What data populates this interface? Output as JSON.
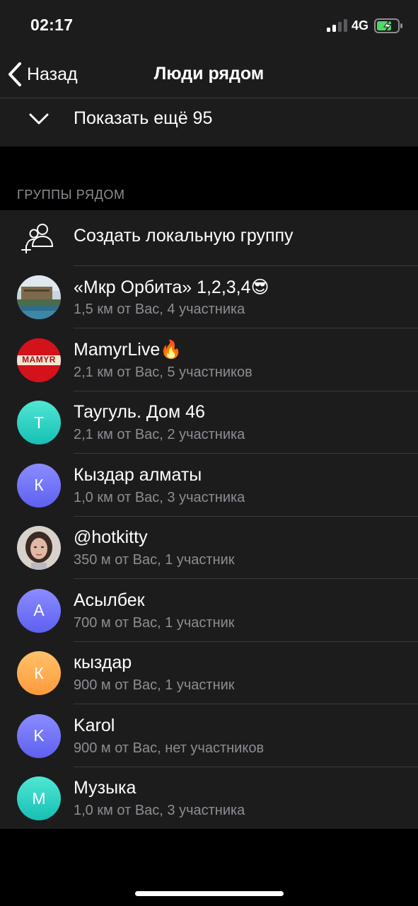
{
  "status": {
    "time": "02:17",
    "network": "4G"
  },
  "nav": {
    "back_label": "Назад",
    "title": "Люди рядом"
  },
  "show_more": {
    "label": "Показать ещё 95"
  },
  "section": {
    "title": "ГРУППЫ РЯДОМ"
  },
  "create_group": {
    "label": "Создать локальную группу"
  },
  "groups": [
    {
      "title": "«Мкр Орбита» 1,2,3,4😎",
      "subtitle": "1,5 км от Вас, 4 участника",
      "avatar_type": "photo-orbita",
      "initial": ""
    },
    {
      "title": "MamyrLive🔥",
      "subtitle": "2,1 км от Вас, 5 участников",
      "avatar_type": "photo-mamyr",
      "initial": "MAMYR"
    },
    {
      "title": "Таугуль. Дом 46",
      "subtitle": "2,1 км от Вас, 2 участника",
      "avatar_type": "initial",
      "initial": "Т",
      "color_top": "#4fe7d3",
      "color_bottom": "#17bfb5"
    },
    {
      "title": "Кыздар алматы",
      "subtitle": "1,0 км от Вас, 3 участника",
      "avatar_type": "initial",
      "initial": "К",
      "color_top": "#8b8cff",
      "color_bottom": "#5e60f0"
    },
    {
      "title": "@hotkitty",
      "subtitle": "350 м от Вас, 1 участник",
      "avatar_type": "photo-person",
      "initial": ""
    },
    {
      "title": "Асылбек",
      "subtitle": "700 м от Вас, 1 участник",
      "avatar_type": "initial",
      "initial": "А",
      "color_top": "#8b8cff",
      "color_bottom": "#5e60f0"
    },
    {
      "title": "кыздар",
      "subtitle": "900 м от Вас, 1 участник",
      "avatar_type": "initial",
      "initial": "К",
      "color_top": "#ffc26a",
      "color_bottom": "#ff9a3c"
    },
    {
      "title": "Karol",
      "subtitle": "900 м от Вас, нет участников",
      "avatar_type": "initial",
      "initial": "K",
      "color_top": "#8b8cff",
      "color_bottom": "#5e60f0"
    },
    {
      "title": "Музыка",
      "subtitle": "1,0 км от Вас, 3 участника",
      "avatar_type": "initial",
      "initial": "М",
      "color_top": "#4fe7d3",
      "color_bottom": "#17bfb5"
    }
  ],
  "colors": {
    "background": "#000000",
    "card": "#1c1c1d",
    "secondary_text": "#8d8d93",
    "separator": "#3a3a3c",
    "battery_charge": "#4cd964"
  },
  "icons": {
    "back": "chevron-left-icon",
    "show_more": "chevron-down-icon",
    "create_group": "add-users-icon",
    "battery": "battery-charging-icon",
    "signal": "cellular-signal-icon"
  }
}
